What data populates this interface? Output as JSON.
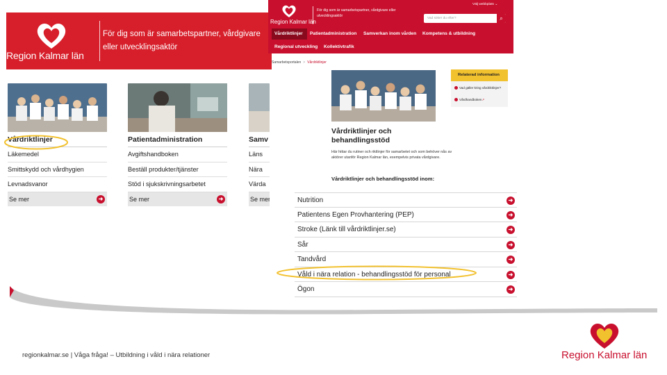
{
  "colors": {
    "brand_red": "#d71f2b",
    "brand_red_dark": "#c8102e",
    "highlight_yellow": "#f2c12e",
    "swoosh_gray": "#c9c9c9"
  },
  "left_screenshot": {
    "brand": "Region Kalmar län",
    "tagline": "För dig som är samarbetspartner, vårdgivare eller utvecklingsaktör",
    "cards": [
      {
        "title": "Vårdriktlinjer",
        "items": [
          "Läkemedel",
          "Smittskydd och vårdhygien",
          "Levnadsvanor"
        ],
        "more": "Se mer"
      },
      {
        "title": "Patientadministration",
        "items": [
          "Avgiftshandboken",
          "Beställ produkter/tjänster",
          "Stöd i sjukskrivningsarbetet"
        ],
        "more": "Se mer"
      },
      {
        "title": "Samv",
        "items": [
          "Läns",
          "Nära",
          "Värda"
        ],
        "more": "Se mer"
      }
    ]
  },
  "right_screenshot": {
    "brand": "Region Kalmar län",
    "tagline": "För dig som är samarbetspartner, vårdgivare eller utvecklingsaktör",
    "language": "Välj webbplats",
    "search_placeholder": "Vad söker du efter?",
    "nav": [
      "Vårdriktlinjer",
      "Patientadministration",
      "Samverkan inom vården",
      "Kompetens & utbildning",
      "Regional utveckling",
      "Kollektivtrafik"
    ],
    "breadcrumb": [
      "Samarbetsportalen",
      "Vårdriktlinjer"
    ],
    "related": {
      "title": "Relaterad information",
      "items": [
        "Vad gäller kring vårdriktlinjer?",
        "Vårdhandboken"
      ]
    },
    "heading": "Vårdriktlinjer och behandlingsstöd",
    "intro": "Här hittar du rutiner och riktlinjer för samarbetet och som behöver nås av aktörer utanför Region Kalmar län, exempelvis privata vårdgivare.",
    "subheading": "Vårdriktlinjer och behandlingsstöd inom:",
    "guidelines": [
      "Nutrition",
      "Patientens Egen Provhantering (PEP)",
      "Stroke (Länk till vårdriktlinjer.se)",
      "Sår",
      "Tandvård",
      "Våld i nära relation - behandlingsstöd för personal",
      "Ögon"
    ]
  },
  "footer": {
    "text": "regionkalmar.se  |  Våga fråga! – Utbildning i våld i nära relationer",
    "brand": "Region Kalmar län"
  }
}
